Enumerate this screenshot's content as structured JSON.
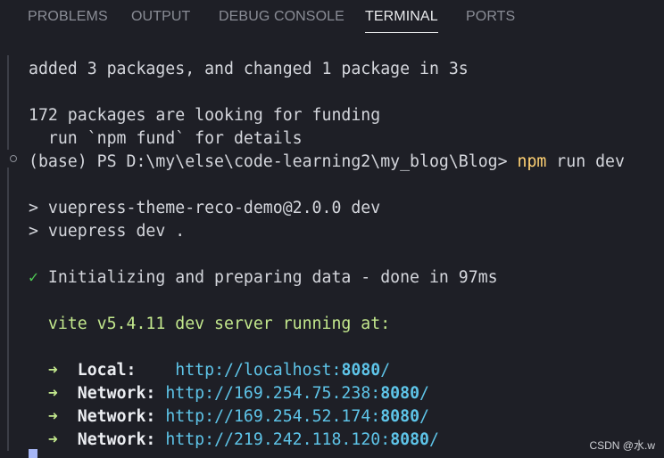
{
  "tabs": [
    {
      "label": "PROBLEMS",
      "active": false
    },
    {
      "label": "OUTPUT",
      "active": false
    },
    {
      "label": "DEBUG CONSOLE",
      "active": false
    },
    {
      "label": "TERMINAL",
      "active": true
    },
    {
      "label": "PORTS",
      "active": false
    }
  ],
  "terminal": {
    "added": "added 3 packages, and changed 1 package in 3s",
    "funding": "172 packages are looking for funding",
    "fund_hint": "  run `npm fund` for details",
    "prompt": "(base) PS D:\\my\\else\\code-learning2\\my_blog\\Blog> ",
    "cmd_npm": "npm",
    "cmd_rest": " run dev",
    "script1": "> vuepress-theme-reco-demo@2.0.0 dev",
    "script2": "> vuepress dev .",
    "check": "✓",
    "init": " Initializing and preparing data - done in 97ms",
    "vite_name": "vite v5.4.11",
    "vite_rest": " dev server running at:",
    "arrow": "➜",
    "urls": [
      {
        "label": "Local:  ",
        "url_base": "http://localhost:",
        "port": "8080",
        "slash": "/"
      },
      {
        "label": "Network:",
        "url_base": "http://169.254.75.238:",
        "port": "8080",
        "slash": "/"
      },
      {
        "label": "Network:",
        "url_base": "http://169.254.52.174:",
        "port": "8080",
        "slash": "/"
      },
      {
        "label": "Network:",
        "url_base": "http://219.242.118.120:",
        "port": "8080",
        "slash": "/"
      }
    ]
  },
  "watermark": "CSDN @水.w",
  "colors": {
    "background": "#1e1f26",
    "npm": "#ffd173",
    "vite": "#c3e88d",
    "check": "#4ec954",
    "url": "#5ec4e8"
  }
}
